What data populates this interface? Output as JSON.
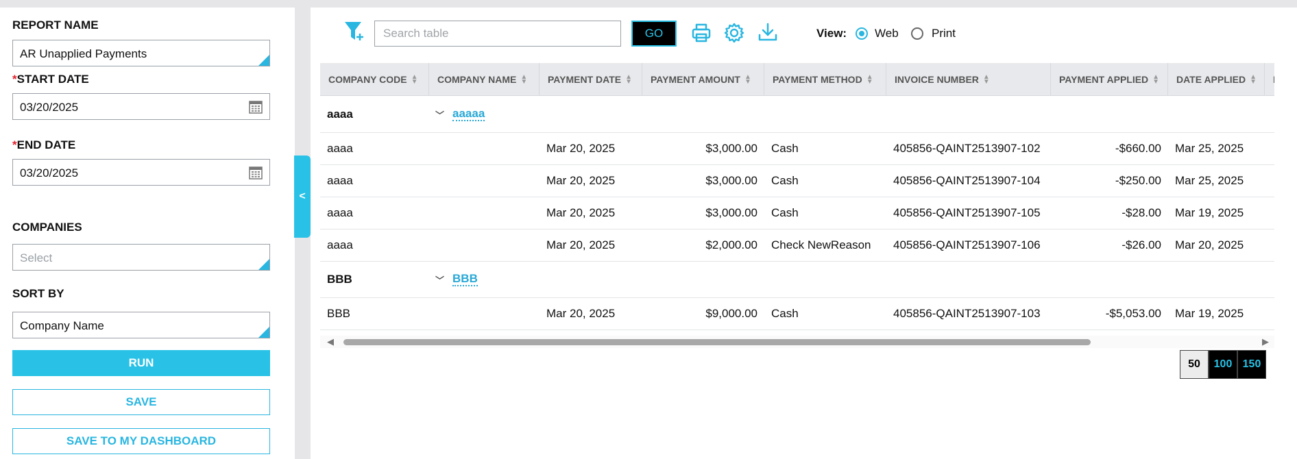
{
  "sidebar": {
    "report_name_label": "REPORT NAME",
    "report_name_value": "AR Unapplied Payments",
    "start_date_label": "START DATE",
    "start_date_value": "03/20/2025",
    "end_date_label": "END DATE",
    "end_date_value": "03/20/2025",
    "required_marker": "*",
    "companies_label": "COMPANIES",
    "companies_placeholder": "Select",
    "sort_by_label": "SORT BY",
    "sort_by_value": "Company Name",
    "run_label": "RUN",
    "save_label": "SAVE",
    "save_dashboard_label": "SAVE TO MY DASHBOARD",
    "collapse_glyph": "<"
  },
  "toolbar": {
    "search_placeholder": "Search table",
    "go_label": "GO",
    "view_label": "View:",
    "view_options": [
      "Web",
      "Print"
    ],
    "view_selected": "Web"
  },
  "table": {
    "columns": [
      "COMPANY CODE",
      "COMPANY NAME",
      "PAYMENT DATE",
      "PAYMENT AMOUNT",
      "PAYMENT METHOD",
      "INVOICE NUMBER",
      "PAYMENT APPLIED",
      "DATE APPLIED",
      "I"
    ],
    "groups": [
      {
        "code": "aaaa",
        "name": "aaaaa",
        "rows": [
          {
            "code": "aaaa",
            "payment_date": "Mar 20, 2025",
            "amount": "$3,000.00",
            "method": "Cash",
            "invoice": "405856-QAINT2513907-102",
            "applied": "-$660.00",
            "date_applied": "Mar 25, 2025"
          },
          {
            "code": "aaaa",
            "payment_date": "Mar 20, 2025",
            "amount": "$3,000.00",
            "method": "Cash",
            "invoice": "405856-QAINT2513907-104",
            "applied": "-$250.00",
            "date_applied": "Mar 25, 2025"
          },
          {
            "code": "aaaa",
            "payment_date": "Mar 20, 2025",
            "amount": "$3,000.00",
            "method": "Cash",
            "invoice": "405856-QAINT2513907-105",
            "applied": "-$28.00",
            "date_applied": "Mar 19, 2025"
          },
          {
            "code": "aaaa",
            "payment_date": "Mar 20, 2025",
            "amount": "$2,000.00",
            "method": "Check NewReason",
            "invoice": "405856-QAINT2513907-106",
            "applied": "-$26.00",
            "date_applied": "Mar 20, 2025"
          }
        ]
      },
      {
        "code": "BBB",
        "name": "BBB",
        "rows": [
          {
            "code": "BBB",
            "payment_date": "Mar 20, 2025",
            "amount": "$9,000.00",
            "method": "Cash",
            "invoice": "405856-QAINT2513907-103",
            "applied": "-$5,053.00",
            "date_applied": "Mar 19, 2025"
          }
        ]
      }
    ]
  },
  "pagination": {
    "sizes": [
      "50",
      "100",
      "150"
    ],
    "selected": "50"
  },
  "colors": {
    "accent": "#29c2e6",
    "required": "#e0202a"
  }
}
